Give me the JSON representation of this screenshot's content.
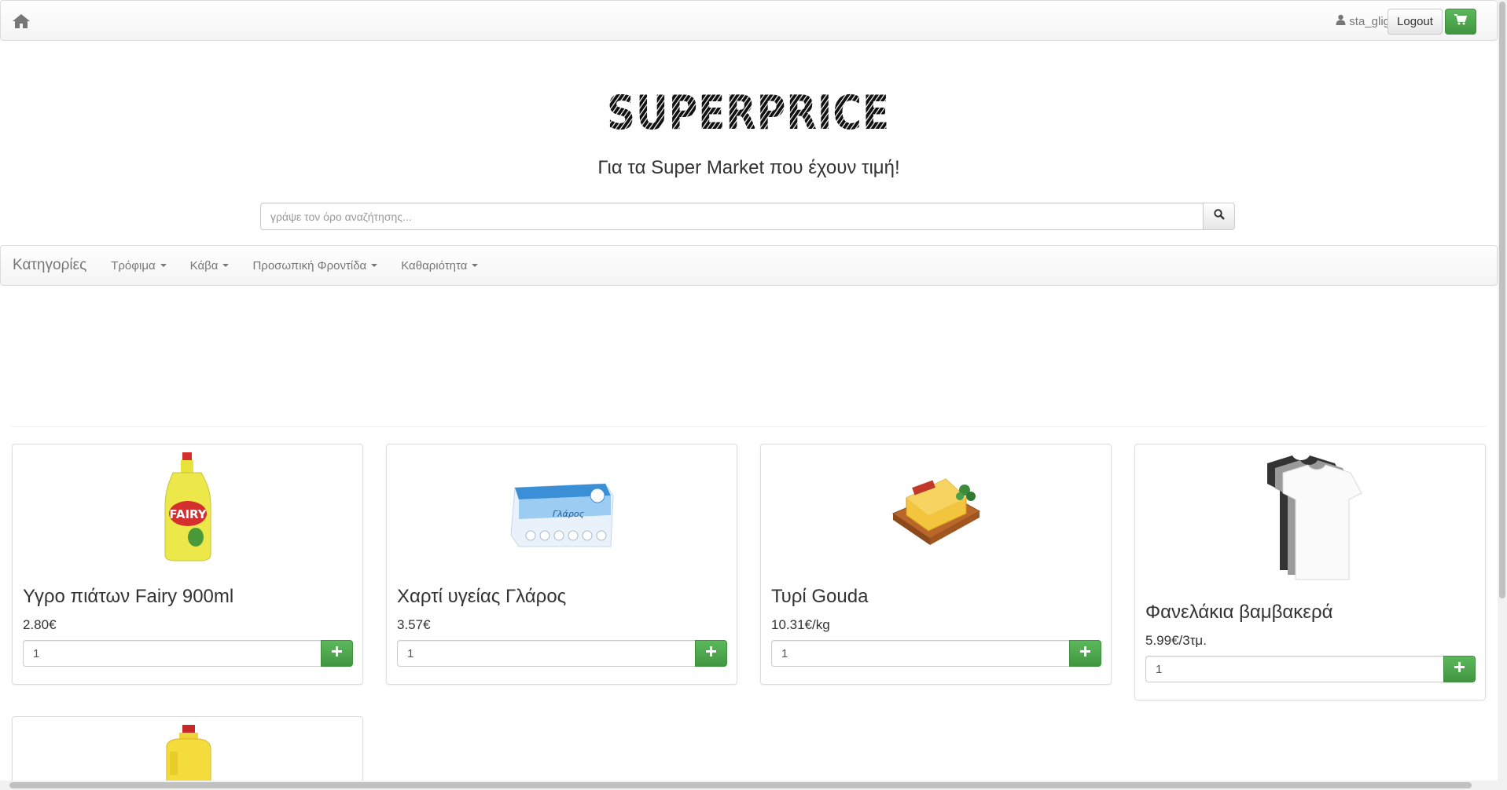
{
  "topbar": {
    "home_icon": "home-icon",
    "username": "sta_glig",
    "user_icon": "user-icon",
    "logout_label": "Logout",
    "cart_icon": "shopping-cart-icon"
  },
  "header": {
    "logo_text": "SUPERPRICE",
    "tagline": "Για τα Super Market που έχουν τιμή!",
    "search_placeholder": "γράψε τον όρο αναζήτησης...",
    "search_icon": "search-icon"
  },
  "categories": {
    "brand": "Κατηγορίες",
    "items": [
      {
        "label": "Τρόφιμα"
      },
      {
        "label": "Κάβα"
      },
      {
        "label": "Προσωπική Φροντίδα"
      },
      {
        "label": "Καθαριότητα"
      }
    ]
  },
  "products": [
    {
      "name": "Υγρο πιάτων Fairy 900ml",
      "price": "2.80€",
      "qty": "1",
      "image": "dish-soap-bottle"
    },
    {
      "name": "Χαρτί υγείας Γλάρος",
      "price": "3.57€",
      "qty": "1",
      "image": "toilet-paper-pack"
    },
    {
      "name": "Τυρί Gouda",
      "price": "10.31€/kg",
      "qty": "1",
      "image": "gouda-cheese"
    },
    {
      "name": "Φανελάκια βαμβακερά",
      "price": "5.99€/3τμ.",
      "qty": "1",
      "image": "cotton-tshirts"
    },
    {
      "name": "",
      "price": "",
      "qty": "",
      "image": "yellow-detergent-bottle"
    }
  ],
  "colors": {
    "accent_green": "#5cb85c",
    "navbar_bg": "#f8f8f8",
    "text_muted": "#777777"
  }
}
